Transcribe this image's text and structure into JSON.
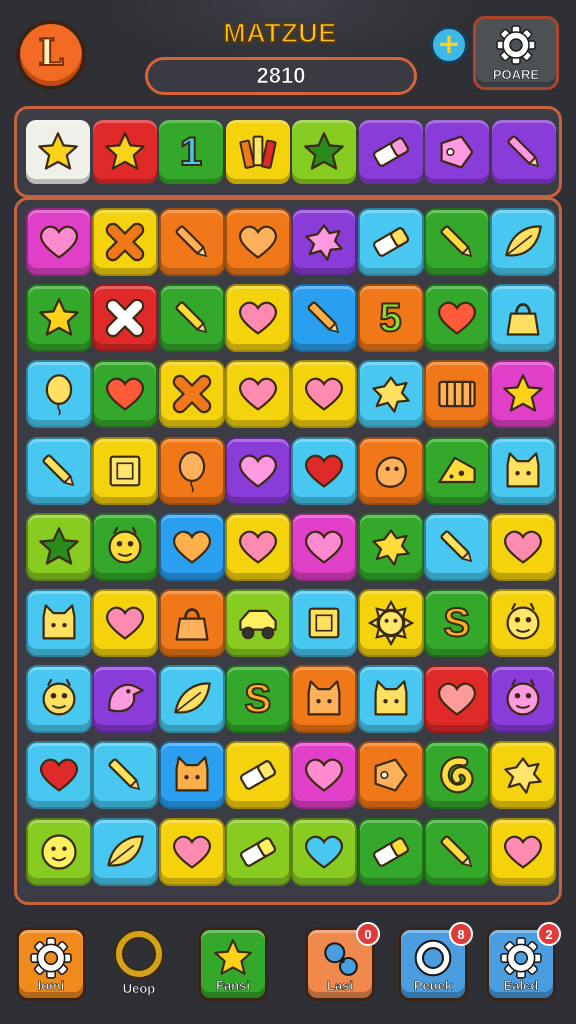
{
  "header": {
    "title": "MATZUE",
    "score": "2810",
    "logo_letter": "L",
    "plus_symbol": "+",
    "pause_label": "POARE"
  },
  "colors": {
    "background": "#2f3036",
    "frame": "#c4633e",
    "title": "#ffc21a",
    "pink": "#e040c8",
    "yellow": "#f4d20c",
    "orange": "#f07818",
    "green": "#34a82a",
    "lime": "#88cc22",
    "blue": "#2a9ff0",
    "sky": "#48c8f0",
    "purple": "#8a3cd8",
    "red": "#e02a2a",
    "white": "#f0f0ea"
  },
  "tray": [
    {
      "color": "white",
      "icon": "star-icon"
    },
    {
      "color": "red",
      "icon": "star-icon"
    },
    {
      "color": "green",
      "icon": "number-icon",
      "text": "1"
    },
    {
      "color": "yellow",
      "icon": "crayons-icon"
    },
    {
      "color": "lime",
      "icon": "star-icon"
    },
    {
      "color": "purple",
      "icon": "eraser-icon"
    },
    {
      "color": "purple",
      "icon": "tag-icon"
    },
    {
      "color": "purple",
      "icon": "pencil-icon"
    }
  ],
  "board": [
    [
      {
        "color": "pink",
        "icon": "heart-icon"
      },
      {
        "color": "yellow",
        "icon": "x-icon"
      },
      {
        "color": "orange",
        "icon": "pencil-icon"
      },
      {
        "color": "orange",
        "icon": "heart-icon"
      },
      {
        "color": "purple",
        "icon": "splat-icon"
      },
      {
        "color": "sky",
        "icon": "eraser-icon"
      },
      {
        "color": "green",
        "icon": "pencil-icon"
      },
      {
        "color": "sky",
        "icon": "leaf-icon"
      }
    ],
    [
      {
        "color": "green",
        "icon": "star-icon"
      },
      {
        "color": "red",
        "icon": "x-icon"
      },
      {
        "color": "green",
        "icon": "pencil-icon"
      },
      {
        "color": "yellow",
        "icon": "heart-icon"
      },
      {
        "color": "blue",
        "icon": "pencil-icon"
      },
      {
        "color": "orange",
        "icon": "number-icon",
        "text": "5"
      },
      {
        "color": "green",
        "icon": "heart-icon"
      },
      {
        "color": "sky",
        "icon": "bag-icon"
      }
    ],
    [
      {
        "color": "sky",
        "icon": "balloon-icon"
      },
      {
        "color": "green",
        "icon": "heart-icon"
      },
      {
        "color": "yellow",
        "icon": "x-icon"
      },
      {
        "color": "yellow",
        "icon": "heart-icon"
      },
      {
        "color": "yellow",
        "icon": "heart-icon"
      },
      {
        "color": "sky",
        "icon": "splat-icon"
      },
      {
        "color": "orange",
        "icon": "crate-icon"
      },
      {
        "color": "pink",
        "icon": "star-icon"
      }
    ],
    [
      {
        "color": "sky",
        "icon": "pencil-icon"
      },
      {
        "color": "yellow",
        "icon": "box-icon"
      },
      {
        "color": "orange",
        "icon": "balloon-icon"
      },
      {
        "color": "purple",
        "icon": "heart-icon"
      },
      {
        "color": "sky",
        "icon": "heart-icon"
      },
      {
        "color": "orange",
        "icon": "blob-icon"
      },
      {
        "color": "green",
        "icon": "cheese-icon"
      },
      {
        "color": "sky",
        "icon": "cat-icon"
      }
    ],
    [
      {
        "color": "lime",
        "icon": "star-icon"
      },
      {
        "color": "green",
        "icon": "monster-icon"
      },
      {
        "color": "blue",
        "icon": "heart-icon"
      },
      {
        "color": "yellow",
        "icon": "heart-icon"
      },
      {
        "color": "pink",
        "icon": "heart-icon"
      },
      {
        "color": "green",
        "icon": "splat-icon"
      },
      {
        "color": "sky",
        "icon": "pencil-icon"
      },
      {
        "color": "yellow",
        "icon": "heart-icon"
      }
    ],
    [
      {
        "color": "sky",
        "icon": "cat-icon"
      },
      {
        "color": "yellow",
        "icon": "heart-icon"
      },
      {
        "color": "orange",
        "icon": "bag-icon"
      },
      {
        "color": "lime",
        "icon": "car-icon"
      },
      {
        "color": "sky",
        "icon": "box-icon"
      },
      {
        "color": "yellow",
        "icon": "sun-icon"
      },
      {
        "color": "green",
        "icon": "number-icon",
        "text": "S"
      },
      {
        "color": "yellow",
        "icon": "monster-icon"
      }
    ],
    [
      {
        "color": "sky",
        "icon": "monster-icon"
      },
      {
        "color": "purple",
        "icon": "bird-icon"
      },
      {
        "color": "sky",
        "icon": "leaf-icon"
      },
      {
        "color": "green",
        "icon": "number-icon",
        "text": "S"
      },
      {
        "color": "orange",
        "icon": "cat-icon"
      },
      {
        "color": "sky",
        "icon": "cat-icon"
      },
      {
        "color": "red",
        "icon": "heart-icon"
      },
      {
        "color": "purple",
        "icon": "monster-icon"
      }
    ],
    [
      {
        "color": "sky",
        "icon": "heart-icon"
      },
      {
        "color": "sky",
        "icon": "pencil-icon"
      },
      {
        "color": "blue",
        "icon": "cat-icon"
      },
      {
        "color": "yellow",
        "icon": "eraser-icon"
      },
      {
        "color": "pink",
        "icon": "heart-icon"
      },
      {
        "color": "orange",
        "icon": "tag-icon"
      },
      {
        "color": "green",
        "icon": "swirl-icon"
      },
      {
        "color": "yellow",
        "icon": "splat-icon"
      }
    ],
    [
      {
        "color": "lime",
        "icon": "face-icon"
      },
      {
        "color": "sky",
        "icon": "leaf-icon"
      },
      {
        "color": "yellow",
        "icon": "heart-icon"
      },
      {
        "color": "lime",
        "icon": "eraser-icon"
      },
      {
        "color": "lime",
        "icon": "heart-icon"
      },
      {
        "color": "green",
        "icon": "eraser-icon"
      },
      {
        "color": "green",
        "icon": "pencil-icon"
      },
      {
        "color": "yellow",
        "icon": "heart-icon"
      }
    ]
  ],
  "bottom_bar": [
    {
      "label": "Iomi",
      "color": "#f08a1c",
      "icon": "gear-icon",
      "badge": ""
    },
    {
      "label": "Ueop",
      "color": "",
      "icon": "ring-icon",
      "badge": ""
    },
    {
      "label": "Fansi",
      "color": "#34a82a",
      "icon": "star-icon",
      "badge": ""
    },
    {
      "label": "Lasi",
      "color": "#f08a4c",
      "icon": "bomb-icon",
      "badge": "0"
    },
    {
      "label": "Peuek",
      "color": "#4a9ee0",
      "icon": "ring-icon",
      "badge": "8"
    },
    {
      "label": "Ealcd",
      "color": "#4a9ee0",
      "icon": "gear-icon",
      "badge": "2"
    }
  ]
}
